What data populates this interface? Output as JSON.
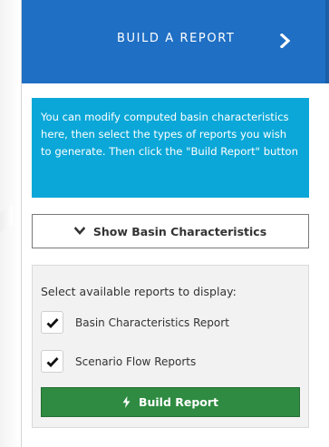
{
  "header": {
    "title": "BUILD A REPORT",
    "icon": "chevron-right-icon",
    "color": "#1f6fc4"
  },
  "info": {
    "text": "You can modify computed basin characteristics here, then select the types of reports you wish to generate. Then click the \"Build Report\" button",
    "color": "#0aa7d8"
  },
  "basin_toggle": {
    "label": "Show Basin Characteristics",
    "icon": "chevron-down-icon"
  },
  "reports": {
    "label": "Select available reports to display:",
    "options": [
      {
        "label": "Basin Characteristics Report",
        "checked": true
      },
      {
        "label": "Scenario Flow Reports",
        "checked": true
      }
    ]
  },
  "build_button": {
    "label": "Build Report",
    "icon": "bolt-icon",
    "color": "#2e8b41"
  }
}
